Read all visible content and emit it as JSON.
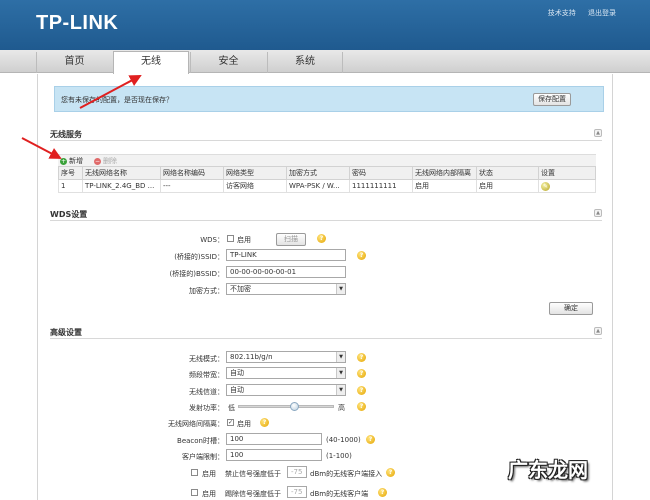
{
  "header": {
    "logo": "TP-LINK",
    "links": [
      "技术支持",
      "退出登录"
    ]
  },
  "nav": {
    "tabs": [
      "首页",
      "无线",
      "安全",
      "系统"
    ],
    "active": "无线"
  },
  "notice": {
    "text": "您有未保存的配置，是否现在保存？",
    "save_label": "保存配置"
  },
  "wireless": {
    "title": "无线服务",
    "add_label": "新增",
    "delete_label": "删除",
    "columns": [
      "序号",
      "无线网络名称",
      "网络名称编码",
      "网络类型",
      "加密方式",
      "密码",
      "无线网络内部隔离",
      "状态",
      "设置"
    ],
    "rows": [
      [
        "1",
        "TP-LINK_2.4G_BD ...",
        "---",
        "访客网络",
        "WPA-PSK / W...",
        "1111111111",
        "启用",
        "启用",
        ""
      ]
    ]
  },
  "wds": {
    "title": "WDS设置",
    "wds_label": "WDS：",
    "enable_label": "启用",
    "scan_label": "扫描",
    "ssid_label": "(桥接的)SSID：",
    "ssid_value": "TP-LINK",
    "bssid_label": "(桥接的)BSSID：",
    "bssid_value": "00-00-00-00-00-01",
    "encrypt_label": "加密方式：",
    "encrypt_value": "不加密",
    "confirm_label": "确定"
  },
  "advanced": {
    "title": "高级设置",
    "mode_label": "无线模式：",
    "mode_value": "802.11b/g/n",
    "bandwidth_label": "频段带宽：",
    "bandwidth_value": "自动",
    "channel_label": "无线信道：",
    "channel_value": "自动",
    "power_label": "发射功率：",
    "power_low": "低",
    "power_high": "高",
    "power_level": 0.58,
    "isolation_label": "无线网络间隔离：",
    "isolation_value": "启用",
    "beacon_label": "Beacon时槽：",
    "beacon_value": "100",
    "beacon_range": "(40-1000)",
    "clients_label": "客户端限制：",
    "clients_value": "100",
    "clients_range": "(1-100)",
    "row1_enable": "启用",
    "row1_prefix": "禁止信号强度低于",
    "row1_value": "-75",
    "row1_suffix": "dBm的无线客户端接入",
    "row2_enable": "启用",
    "row2_prefix": "踢除信号强度低于",
    "row2_value": "-75",
    "row2_suffix": "dBm的无线客户端"
  },
  "watermark": "广东龙网"
}
